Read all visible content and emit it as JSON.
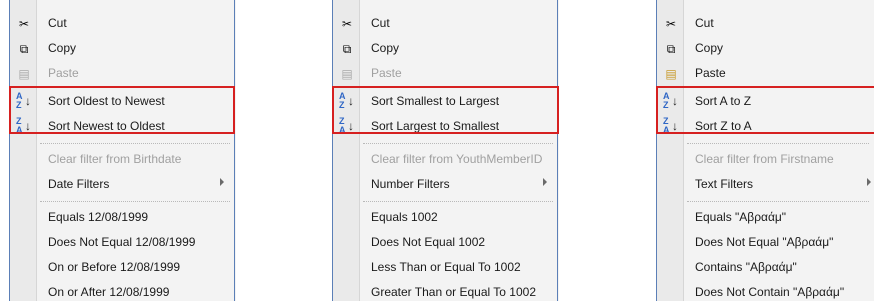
{
  "menus": [
    {
      "cut": "Cut",
      "copy": "Copy",
      "paste": "Paste",
      "sort_asc": "Sort Oldest to Newest",
      "sort_desc": "Sort Newest to Oldest",
      "clear": "Clear filter from Birthdate",
      "filters": "Date Filters",
      "opt1": "Equals 12/08/1999",
      "opt2": "Does Not Equal 12/08/1999",
      "opt3": "On or Before 12/08/1999",
      "opt4": "On or After 12/08/1999"
    },
    {
      "cut": "Cut",
      "copy": "Copy",
      "paste": "Paste",
      "sort_asc": "Sort Smallest to Largest",
      "sort_desc": "Sort Largest to Smallest",
      "clear": "Clear filter from YouthMemberID",
      "filters": "Number Filters",
      "opt1": "Equals 1002",
      "opt2": "Does Not Equal 1002",
      "opt3": "Less Than or Equal To 1002",
      "opt4": "Greater Than or Equal To 1002"
    },
    {
      "cut": "Cut",
      "copy": "Copy",
      "paste": "Paste",
      "sort_asc": "Sort A to Z",
      "sort_desc": "Sort Z to A",
      "clear": "Clear filter from Firstname",
      "filters": "Text Filters",
      "opt1": "Equals \"Αβραάμ\"",
      "opt2": "Does Not Equal \"Αβραάμ\"",
      "opt3": "Contains \"Αβραάμ\"",
      "opt4": "Does Not Contain \"Αβραάμ\""
    }
  ],
  "icons": {
    "cut": "scissors-icon",
    "copy": "copy-icon",
    "paste": "paste-icon",
    "sort_asc": "sort-ascending-icon",
    "sort_desc": "sort-descending-icon"
  },
  "colors": {
    "highlight": "#d62020",
    "border": "#5b7fb7"
  }
}
